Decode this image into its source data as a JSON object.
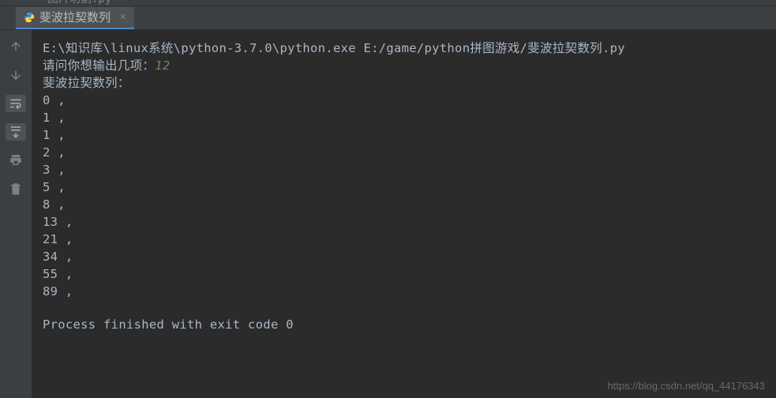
{
  "top_remnant": {
    "label": "图片切割.py"
  },
  "tab": {
    "title": "斐波拉契数列",
    "icon": "python-file-icon"
  },
  "console": {
    "command": "E:\\知识库\\linux系统\\python-3.7.0\\python.exe E:/game/python拼图游戏/斐波拉契数列.py",
    "prompt_text": "请问你想输出几项：",
    "user_input": "12",
    "header_line": "斐波拉契数列：",
    "fibonacci": [
      "0",
      "1",
      "1",
      "2",
      "3",
      "5",
      "8",
      "13",
      "21",
      "34",
      "55",
      "89"
    ],
    "separator": " ,",
    "exit_message": "Process finished with exit code 0"
  },
  "gutter_icons": {
    "up": "arrow-up-icon",
    "down": "arrow-down-icon",
    "wrap": "soft-wrap-icon",
    "scroll": "scroll-to-end-icon",
    "print": "print-icon",
    "trash": "trash-icon"
  },
  "watermark": "https://blog.csdn.net/qq_44176343"
}
